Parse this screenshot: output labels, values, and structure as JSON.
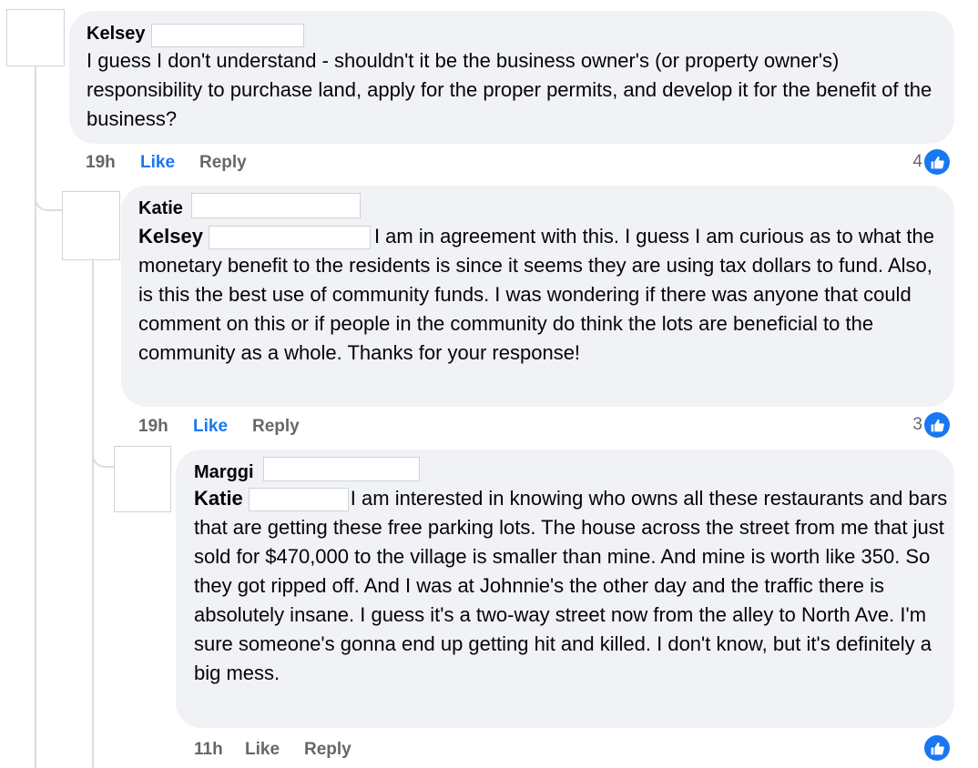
{
  "comments": [
    {
      "author": "Kelsey",
      "text": "I guess I don't understand - shouldn't it be the business owner's (or property owner's) responsibility to purchase land, apply for the proper permits, and develop it for the benefit of the business?",
      "time": "19h",
      "like_label": "Like",
      "reply_label": "Reply",
      "reaction_count": "4",
      "liked": true
    },
    {
      "author": "Katie",
      "mention": "Kelsey",
      "text": "I am in agreement with this. I guess I am curious as to what the monetary benefit to the residents is since it seems they are using tax dollars to fund. Also, is this the best use of community funds. I was wondering if there was anyone that could comment on this or if people in the community do think the lots are beneficial to the community as a whole. Thanks for your response!",
      "time": "19h",
      "like_label": "Like",
      "reply_label": "Reply",
      "reaction_count": "3",
      "liked": true
    },
    {
      "author": "Marggi",
      "mention": "Katie",
      "text": "I am interested in knowing who owns all these restaurants and bars that are getting these free parking lots. The house across the street from me that just sold for $470,000 to the village is smaller than mine. And mine is worth like 350. So they got ripped off. And I was at Johnnie's the other day and the traffic there is   absolutely insane. I guess it's a two-way street now from the alley to North Ave. I'm sure someone's gonna end up getting hit and killed. I don't know, but it's definitely a big mess.",
      "time": "11h",
      "like_label": "Like",
      "reply_label": "Reply",
      "reaction_count": "",
      "liked": false
    }
  ],
  "icons": {
    "reaction": "like-thumb-icon"
  },
  "colors": {
    "accent": "#1877f2",
    "bubble": "#f0f2f5",
    "muted": "#65676b"
  }
}
